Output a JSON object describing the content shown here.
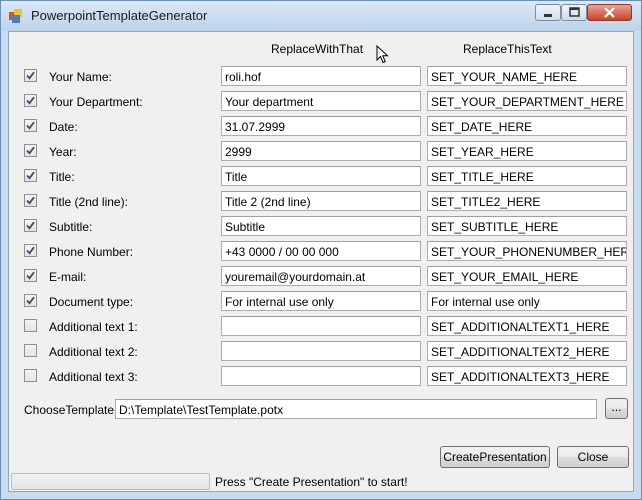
{
  "window": {
    "title": "PowerpointTemplateGenerator"
  },
  "headers": {
    "replace_with": "ReplaceWithThat",
    "replace_this": "ReplaceThisText"
  },
  "rows": [
    {
      "label": "Your Name:",
      "checked": true,
      "value": "roli.hof",
      "placeholder": "SET_YOUR_NAME_HERE"
    },
    {
      "label": "Your Department:",
      "checked": true,
      "value": "Your department",
      "placeholder": "SET_YOUR_DEPARTMENT_HERE"
    },
    {
      "label": "Date:",
      "checked": true,
      "value": "31.07.2999",
      "placeholder": "SET_DATE_HERE"
    },
    {
      "label": "Year:",
      "checked": true,
      "value": "2999",
      "placeholder": "SET_YEAR_HERE"
    },
    {
      "label": "Title:",
      "checked": true,
      "value": "Title",
      "placeholder": "SET_TITLE_HERE"
    },
    {
      "label": "Title (2nd line):",
      "checked": true,
      "value": "Title 2 (2nd line)",
      "placeholder": "SET_TITLE2_HERE"
    },
    {
      "label": "Subtitle:",
      "checked": true,
      "value": "Subtitle",
      "placeholder": "SET_SUBTITLE_HERE"
    },
    {
      "label": "Phone Number:",
      "checked": true,
      "value": "+43 0000 / 00 00 000",
      "placeholder": "SET_YOUR_PHONENUMBER_HERE"
    },
    {
      "label": "E-mail:",
      "checked": true,
      "value": "youremail@yourdomain.at",
      "placeholder": "SET_YOUR_EMAIL_HERE"
    },
    {
      "label": "Document type:",
      "checked": true,
      "value": "For internal use only",
      "placeholder": "For internal use only"
    },
    {
      "label": "Additional text 1:",
      "checked": false,
      "value": "",
      "placeholder": "SET_ADDITIONALTEXT1_HERE"
    },
    {
      "label": "Additional text 2:",
      "checked": false,
      "value": "",
      "placeholder": "SET_ADDITIONALTEXT2_HERE"
    },
    {
      "label": "Additional text 3:",
      "checked": false,
      "value": "",
      "placeholder": "SET_ADDITIONALTEXT3_HERE"
    }
  ],
  "template": {
    "label": "ChooseTemplate",
    "path": "D:\\Template\\TestTemplate.potx",
    "browse_label": "..."
  },
  "buttons": {
    "create": "CreatePresentation",
    "close": "Close"
  },
  "status": {
    "text": "Press \"Create Presentation\" to start!",
    "progress": 0
  }
}
